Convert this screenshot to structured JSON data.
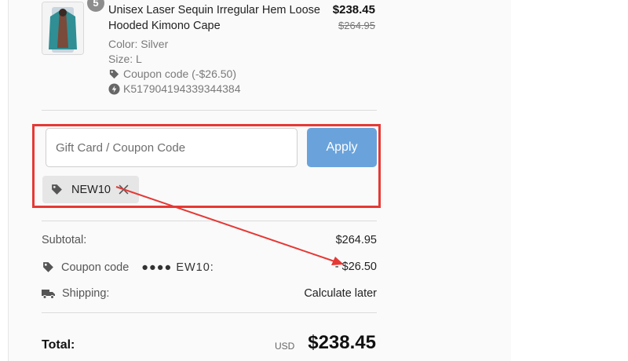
{
  "product": {
    "quantity_badge": "5",
    "title": "Unisex Laser Sequin Irregular Hem Loose Hooded Kimono Cape",
    "price": "$238.45",
    "original_price": "$264.95",
    "color": "Color: Silver",
    "size": "Size: L",
    "coupon_line": "Coupon code (-$26.50)",
    "sku": "K517904194339344384"
  },
  "coupon": {
    "placeholder": "Gift Card / Coupon Code",
    "apply_label": "Apply",
    "applied_code": "NEW10"
  },
  "summary": {
    "subtotal_label": "Subtotal:",
    "subtotal_value": "$264.95",
    "coupon_label": "Coupon code",
    "coupon_masked": "●●●● EW10:",
    "coupon_value": "- $26.50",
    "shipping_label": "Shipping:",
    "shipping_value": "Calculate later",
    "total_label": "Total:",
    "currency": "USD",
    "total_value": "$238.45"
  },
  "colors": {
    "annotation": "#e53935",
    "apply_button": "#6aa3dc"
  }
}
